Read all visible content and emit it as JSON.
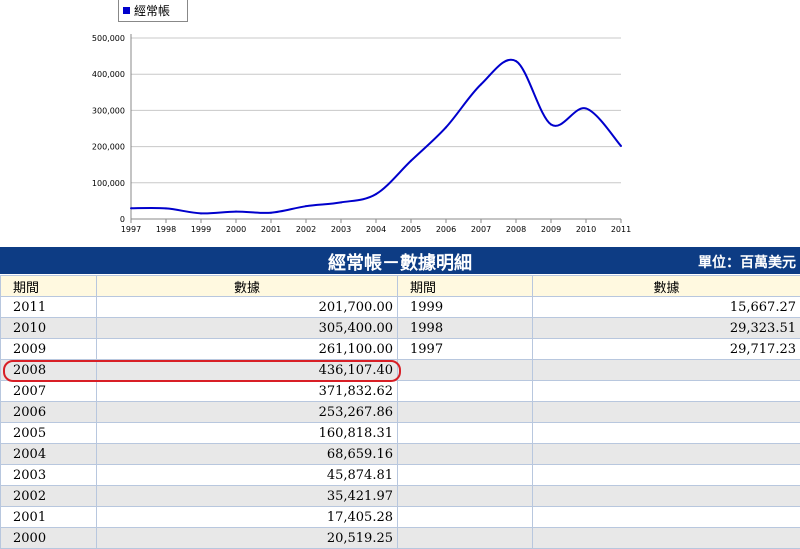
{
  "chart_data": {
    "type": "line",
    "x": [
      "1997",
      "1998",
      "1999",
      "2000",
      "2001",
      "2002",
      "2003",
      "2004",
      "2005",
      "2006",
      "2007",
      "2008",
      "2009",
      "2010",
      "2011"
    ],
    "series": [
      {
        "name": "經常帳",
        "values": [
          29717.23,
          29323.51,
          15667.27,
          20519.25,
          17405.28,
          35421.97,
          45874.81,
          68659.16,
          160818.31,
          253267.86,
          371832.62,
          436107.4,
          261100.0,
          305400.0,
          201700.0
        ]
      }
    ],
    "y_ticks": [
      "0",
      "100,000",
      "200,000",
      "300,000",
      "400,000",
      "500,000"
    ],
    "ylim": [
      0,
      500000
    ],
    "grid": true,
    "line_color": "#0000cc",
    "legend_position": "top-left"
  },
  "table": {
    "title": "經常帳－數據明細",
    "unit": "單位：百萬美元",
    "headers": [
      "期間",
      "數據",
      "期間",
      "數據"
    ],
    "rows": [
      {
        "y1": "2011",
        "v1": "201,700.00",
        "y2": "1999",
        "v2": "15,667.27"
      },
      {
        "y1": "2010",
        "v1": "305,400.00",
        "y2": "1998",
        "v2": "29,323.51"
      },
      {
        "y1": "2009",
        "v1": "261,100.00",
        "y2": "1997",
        "v2": "29,717.23"
      },
      {
        "y1": "2008",
        "v1": "436,107.40",
        "y2": "",
        "v2": ""
      },
      {
        "y1": "2007",
        "v1": "371,832.62",
        "y2": "",
        "v2": ""
      },
      {
        "y1": "2006",
        "v1": "253,267.86",
        "y2": "",
        "v2": ""
      },
      {
        "y1": "2005",
        "v1": "160,818.31",
        "y2": "",
        "v2": ""
      },
      {
        "y1": "2004",
        "v1": "68,659.16",
        "y2": "",
        "v2": ""
      },
      {
        "y1": "2003",
        "v1": "45,874.81",
        "y2": "",
        "v2": ""
      },
      {
        "y1": "2002",
        "v1": "35,421.97",
        "y2": "",
        "v2": ""
      },
      {
        "y1": "2001",
        "v1": "17,405.28",
        "y2": "",
        "v2": ""
      },
      {
        "y1": "2000",
        "v1": "20,519.25",
        "y2": "",
        "v2": ""
      }
    ]
  },
  "highlight_color": "#d81f26"
}
